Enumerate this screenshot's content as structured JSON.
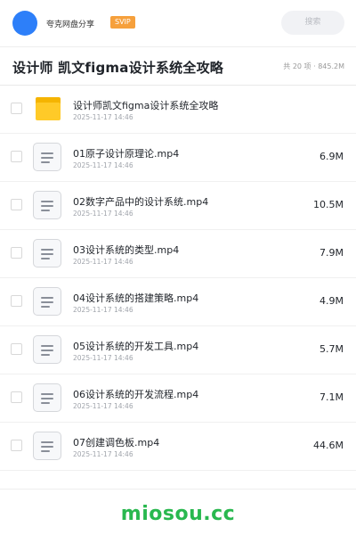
{
  "header": {
    "brand": "夸克网盘分享",
    "badge": "SVIP",
    "search_label": "搜索"
  },
  "folder": {
    "title": "设计师 凯文figma设计系统全攻略",
    "meta": "共 20 项 · 845.2M"
  },
  "files": [
    {
      "type": "folder",
      "icon": "folder-icon",
      "name": "设计师凯文figma设计系统全攻略",
      "date": "2025-11-17 14:46",
      "size": ""
    },
    {
      "type": "file",
      "icon": "document-icon",
      "name": "01原子设计原理论.mp4",
      "date": "2025-11-17 14:46",
      "size": "6.9M"
    },
    {
      "type": "file",
      "icon": "document-icon",
      "name": "02数字产品中的设计系统.mp4",
      "date": "2025-11-17 14:46",
      "size": "10.5M"
    },
    {
      "type": "file",
      "icon": "document-icon",
      "name": "03设计系统的类型.mp4",
      "date": "2025-11-17 14:46",
      "size": "7.9M"
    },
    {
      "type": "file",
      "icon": "document-icon",
      "name": "04设计系统的搭建策略.mp4",
      "date": "2025-11-17 14:46",
      "size": "4.9M"
    },
    {
      "type": "file",
      "icon": "document-icon",
      "name": "05设计系统的开发工具.mp4",
      "date": "2025-11-17 14:46",
      "size": "5.7M"
    },
    {
      "type": "file",
      "icon": "document-icon",
      "name": "06设计系统的开发流程.mp4",
      "date": "2025-11-17 14:46",
      "size": "7.1M"
    },
    {
      "type": "file",
      "icon": "document-icon",
      "name": "07创建调色板.mp4",
      "date": "2025-11-17 14:46",
      "size": "44.6M"
    }
  ],
  "watermark": "miosou.cc",
  "colors": {
    "accent": "#2d7ff9",
    "svip": "#f6a03c",
    "folder": "#ffca28",
    "watermark": "#29b84f"
  }
}
